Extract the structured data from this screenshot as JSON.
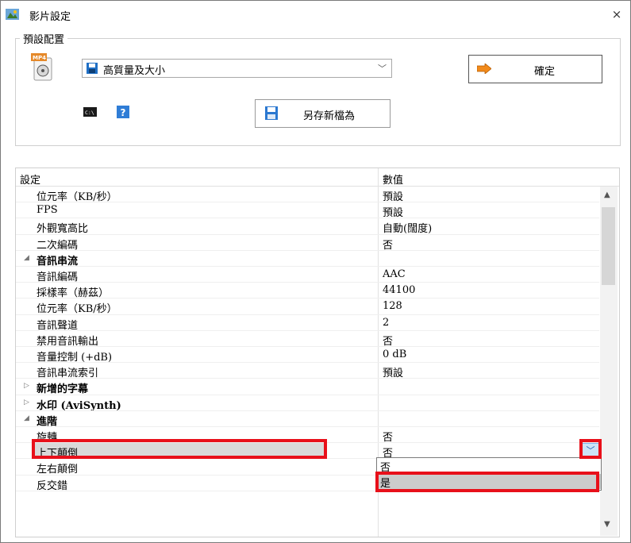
{
  "window": {
    "title": "影片設定",
    "close_glyph": "×"
  },
  "preset": {
    "group_label": "預設配置",
    "format_badge": "MP4",
    "selected": "高質量及大小",
    "confirm_label": "確定",
    "save_as_label": "另存新檔為",
    "cmd_badge": "C:\\",
    "help_glyph": "?"
  },
  "grid": {
    "col_setting": "設定",
    "col_value": "數值",
    "rows": [
      {
        "name": "位元率（KB/秒）",
        "value": "預設"
      },
      {
        "name": "FPS",
        "value": "預設"
      },
      {
        "name": "外觀寬高比",
        "value": "自動(闊度)"
      },
      {
        "name": "二次編碼",
        "value": "否"
      },
      {
        "name": "音訊串流",
        "category": true,
        "expanded": true
      },
      {
        "name": "音訊編碼",
        "value": "AAC"
      },
      {
        "name": "採樣率（赫茲）",
        "value": "44100"
      },
      {
        "name": "位元率（KB/秒）",
        "value": "128"
      },
      {
        "name": "音訊聲道",
        "value": "2"
      },
      {
        "name": "禁用音訊輸出",
        "value": "否"
      },
      {
        "name": "音量控制 (+dB)",
        "value": "0 dB"
      },
      {
        "name": "音訊串流索引",
        "value": "預設"
      },
      {
        "name": "新增的字幕",
        "category": true,
        "expanded": false
      },
      {
        "name": "水印 (AviSynth)",
        "category": true,
        "expanded": false
      },
      {
        "name": "進階",
        "category": true,
        "expanded": true
      },
      {
        "name": "旋轉",
        "value": "否"
      },
      {
        "name": "上下顛倒",
        "value": "否",
        "selected": true
      },
      {
        "name": "左右顛倒",
        "value": ""
      },
      {
        "name": "反交錯",
        "value": ""
      }
    ],
    "dropdown_options": [
      "否",
      "是"
    ],
    "dropdown_highlighted": "是"
  },
  "colors": {
    "highlight_red": "#e8101a",
    "selected_row": "#d9d9d9",
    "dropdown_hover": "#cccccc"
  }
}
